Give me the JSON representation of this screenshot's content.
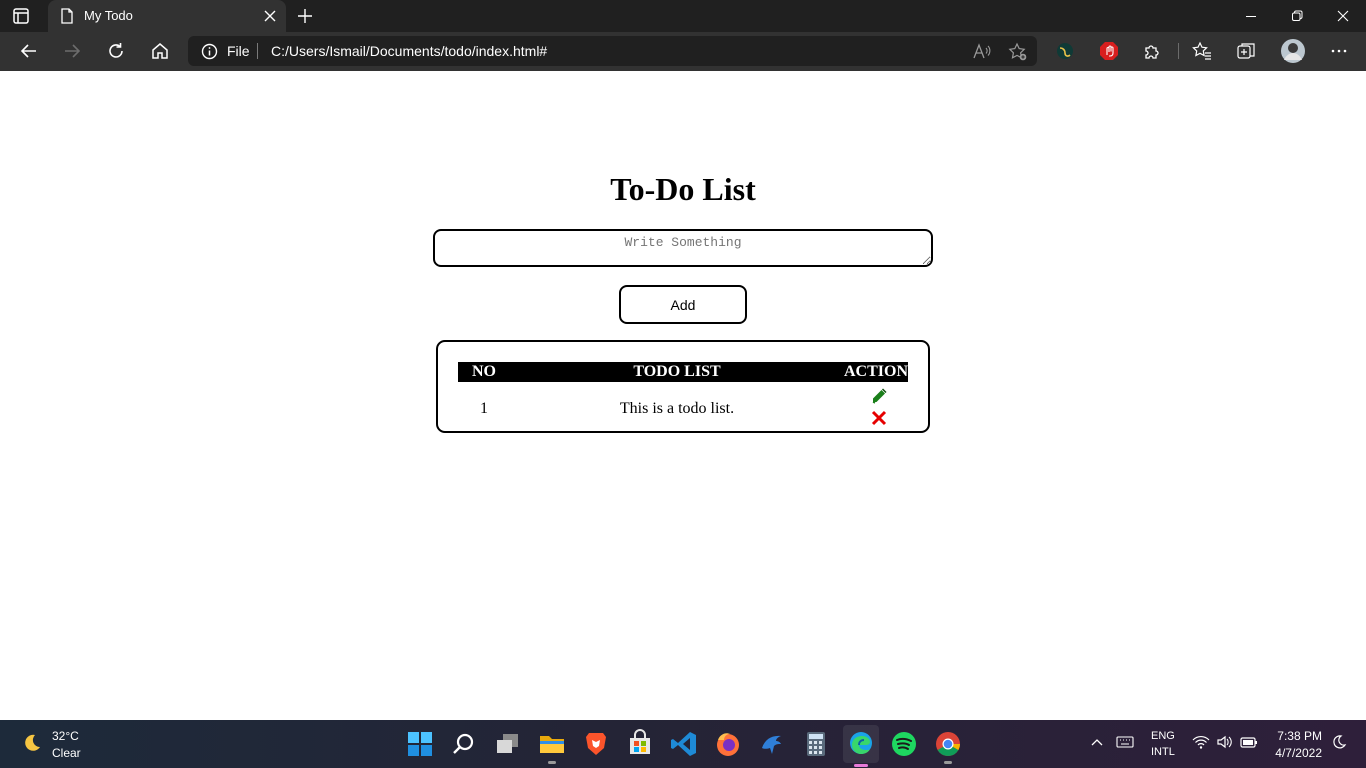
{
  "browser": {
    "tab_title": "My Todo",
    "address": {
      "security_label": "File",
      "url": "C:/Users/Ismail/Documents/todo/index.html#"
    },
    "icons": [
      "tab-actions-icon",
      "document-icon",
      "close-icon",
      "plus-icon",
      "minimize-icon",
      "restore-icon",
      "window-close-icon",
      "back-icon",
      "forward-icon",
      "refresh-icon",
      "home-icon",
      "info-icon",
      "read-aloud-icon",
      "add-favorite-icon",
      "extension-icon",
      "adblock-icon",
      "extensions-icon",
      "favorites-icon",
      "collections-icon",
      "profile-avatar",
      "more-icon"
    ]
  },
  "app": {
    "heading": "To-Do List",
    "input": {
      "placeholder": "Write Something",
      "value": ""
    },
    "add_button": "Add",
    "table": {
      "headers": {
        "no": "NO",
        "todo": "TODO LIST",
        "action": "ACTION"
      },
      "rows": [
        {
          "no": "1",
          "todo": "This is a todo list."
        }
      ]
    },
    "colors": {
      "edit_icon": "#1a7f1a",
      "delete_icon": "#e60000",
      "header_bg": "#000000"
    }
  },
  "taskbar": {
    "weather": {
      "temp": "32°C",
      "desc": "Clear"
    },
    "apps": [
      "start",
      "search",
      "task-view",
      "file-explorer",
      "brave",
      "microsoft-store",
      "vscode",
      "firefox",
      "dolphin",
      "calculator",
      "edge",
      "spotify",
      "chrome"
    ],
    "language": {
      "line1": "ENG",
      "line2": "INTL"
    },
    "clock": {
      "time": "7:38 PM",
      "date": "4/7/2022"
    }
  }
}
